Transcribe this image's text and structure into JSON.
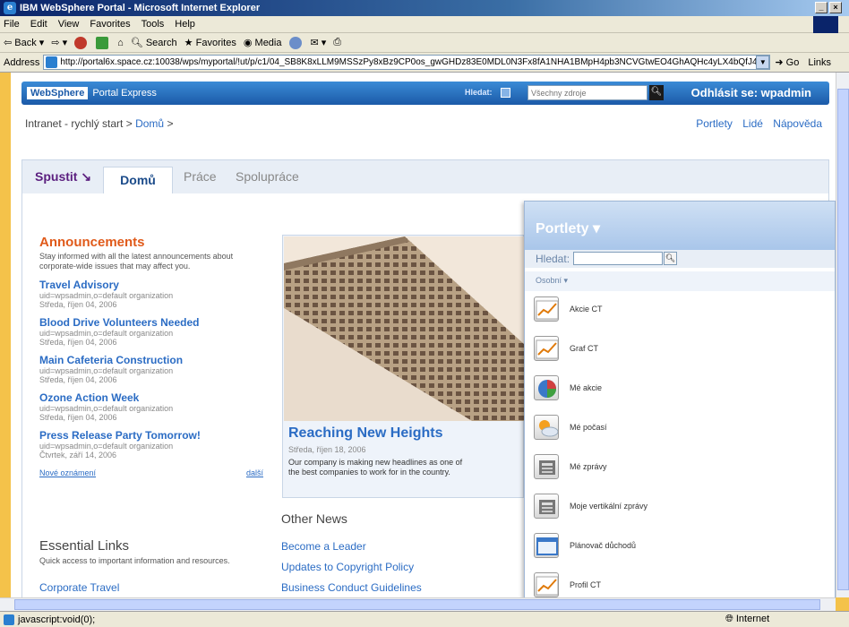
{
  "window": {
    "title": "IBM WebSphere Portal - Microsoft Internet Explorer",
    "controls": [
      "_",
      "×"
    ]
  },
  "menu": [
    "File",
    "Edit",
    "View",
    "Favorites",
    "Tools",
    "Help"
  ],
  "toolbar": {
    "back": "Back",
    "search": "Search",
    "favorites": "Favorites",
    "media": "Media"
  },
  "address": {
    "label": "Address",
    "url": "http://portal6x.space.cz:10038/wps/myportal/!ut/p/c1/04_SB8K8xLLM9MSSzPy8xBz9CP0os_gwGHDz83E0MDL0N3Fx8fA1NHA1BMpH4pb3NCVGtwEO4GhAQHc4yLX4bQfJ4zHF",
    "go": "Go",
    "links": "Links"
  },
  "portal": {
    "brand": "WebSphere",
    "product": "Portal Express",
    "search_label": "Hledat:",
    "search_placeholder": "Všechny zdroje",
    "logout": "Odhlásit se: wpadmin"
  },
  "breadcrumb": {
    "root": "Intranet - rychlý start",
    "sep": ">",
    "current": "Domů",
    "trail": ">"
  },
  "toplinks": [
    "Portlety",
    "Lidé",
    "Nápověda"
  ],
  "tabs": {
    "launch": "Spustit ↘",
    "active": "Domů",
    "others": [
      "Práce",
      "Spolupráce"
    ]
  },
  "announcements": {
    "title": "Announcements",
    "desc": "Stay informed with all the latest announcements about corporate-wide issues that may affect you.",
    "items": [
      {
        "title": "Travel Advisory",
        "author": "uid=wpsadmin,o=default organization",
        "date": "Středa, říjen 04, 2006"
      },
      {
        "title": "Blood Drive Volunteers Needed",
        "author": "uid=wpsadmin,o=default organization",
        "date": "Středa, říjen 04, 2006"
      },
      {
        "title": "Main Cafeteria Construction",
        "author": "uid=wpsadmin,o=default organization",
        "date": "Středa, říjen 04, 2006"
      },
      {
        "title": "Ozone Action Week",
        "author": "uid=wpsadmin,o=default organization",
        "date": "Středa, říjen 04, 2006"
      },
      {
        "title": "Press Release Party Tomorrow!",
        "author": "uid=wpsadmin,o=default organization",
        "date": "Čtvrtek, září 14, 2006"
      }
    ],
    "new_link": "Nové oznámení",
    "more_link": "další"
  },
  "links": {
    "title": "Essential Links",
    "desc": "Quick access to important information and resources.",
    "items": [
      "Corporate Travel"
    ]
  },
  "feature": {
    "title": "Reaching New Heights",
    "date": "Středa, říjen 18, 2006",
    "body": "Our company is making new headlines as one of the best companies to work for in the country."
  },
  "other_news": {
    "title": "Other News",
    "items": [
      "Become a Leader",
      "Updates to Copyright Policy",
      "Business Conduct Guidelines"
    ]
  },
  "palette": {
    "title": "Portlety ▾",
    "search_label": "Hledat:",
    "category": "Osobní ▾",
    "items": [
      {
        "label": "Akcie CT",
        "icon": "chart-icon"
      },
      {
        "label": "Graf CT",
        "icon": "chart-icon"
      },
      {
        "label": "Mé akcie",
        "icon": "pie-chart-icon"
      },
      {
        "label": "Mé počasí",
        "icon": "weather-icon"
      },
      {
        "label": "Mé zprávy",
        "icon": "news-icon"
      },
      {
        "label": "Moje vertikální zprávy",
        "icon": "news-icon"
      },
      {
        "label": "Plánovač důchodů",
        "icon": "window-icon"
      },
      {
        "label": "Profil CT",
        "icon": "chart-icon"
      }
    ]
  },
  "status": {
    "text": "javascript:void(0);",
    "zone": "Internet"
  }
}
